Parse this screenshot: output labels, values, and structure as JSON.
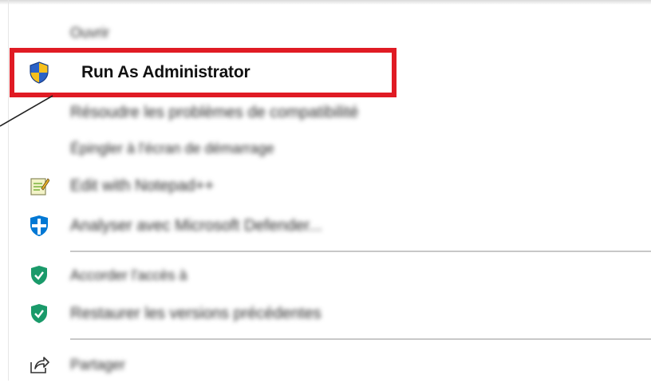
{
  "menu": {
    "items": [
      {
        "label": "Ouvrir",
        "icon": "",
        "blurred": true
      },
      {
        "label": "Run As Administrator",
        "icon": "uac-shield-icon",
        "blurred": false
      },
      {
        "label": "Résoudre les problèmes de compatibilité",
        "icon": "",
        "blurred": true
      },
      {
        "label": "Épingler à l'écran de démarrage",
        "icon": "",
        "blurred": true
      },
      {
        "label": "Edit with Notepad++",
        "icon": "notepad-icon",
        "blurred": true
      },
      {
        "label": "Analyser avec Microsoft Defender...",
        "icon": "defender-icon",
        "blurred": true
      },
      {
        "label": "Accorder l'accès à",
        "icon": "green-shield-icon",
        "blurred": true
      },
      {
        "label": "Restaurer les versions précédentes",
        "icon": "green-shield-icon",
        "blurred": true
      },
      {
        "label": "Partager",
        "icon": "share-icon",
        "blurred": true
      }
    ]
  },
  "colors": {
    "highlight_border": "#e01b24",
    "uac_blue": "#2b62c7",
    "uac_yellow": "#f6c01c",
    "defender_blue": "#0078d4",
    "green_shield": "#1a9a6a"
  }
}
